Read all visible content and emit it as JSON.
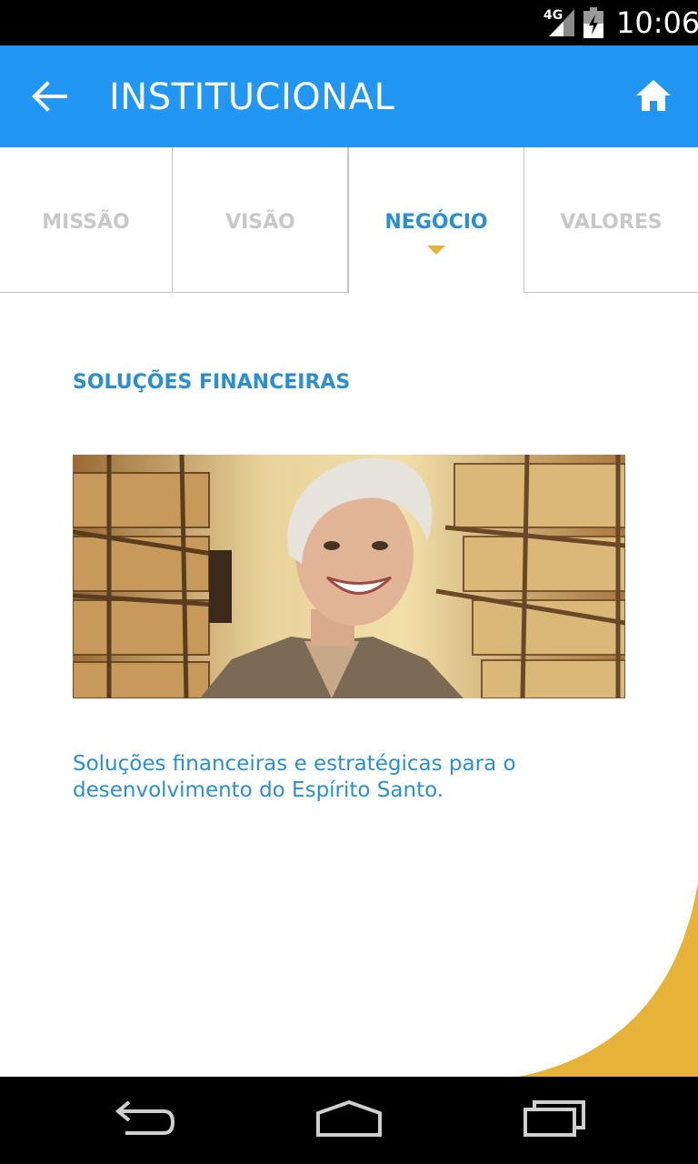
{
  "status_bar": {
    "network_label": "4G",
    "time": "10:06"
  },
  "app_bar": {
    "title": "INSTITUCIONAL",
    "back_icon": "arrow-left-icon",
    "home_icon": "home-icon"
  },
  "tabs": [
    {
      "label": "MISSÃO",
      "active": false
    },
    {
      "label": "VISÃO",
      "active": false
    },
    {
      "label": "NEGÓCIO",
      "active": true
    },
    {
      "label": "VALORES",
      "active": false
    }
  ],
  "content": {
    "section_title": "SOLUÇÕES FINANCEIRAS",
    "description": "Soluções financeiras e estratégicas para o desenvolvimento do Espírito Santo.",
    "photo": "smiling-woman-in-warehouse-photo"
  },
  "nav_bar": {
    "back_icon": "nav-back-icon",
    "home_icon": "nav-home-icon",
    "recents_icon": "nav-recents-icon"
  },
  "colors": {
    "primary": "#2196f3",
    "accent_text": "#2a8fd0",
    "inactive_tab": "#c8c8c8",
    "highlight": "#e6b237"
  }
}
